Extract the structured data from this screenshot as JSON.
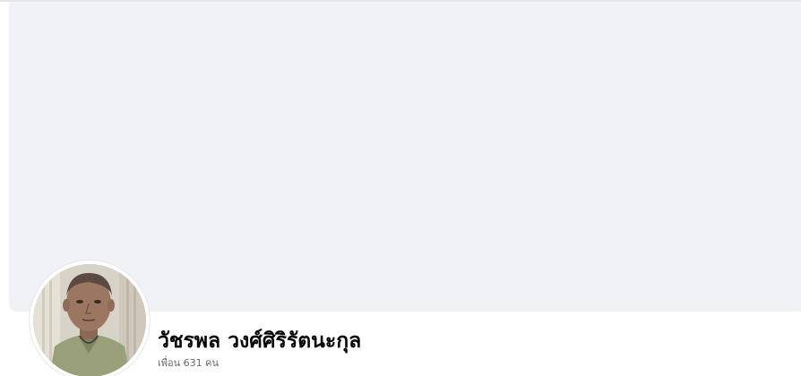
{
  "profile": {
    "name": "วัชรพล วงศ์ศิริรัตนะกุล",
    "friends_text": "เพื่อน 631 คน",
    "avatar_icon": "profile-photo"
  },
  "colors": {
    "cover_bg": "#f0f2f5",
    "name_color": "#050505",
    "secondary_text": "#65676b"
  }
}
